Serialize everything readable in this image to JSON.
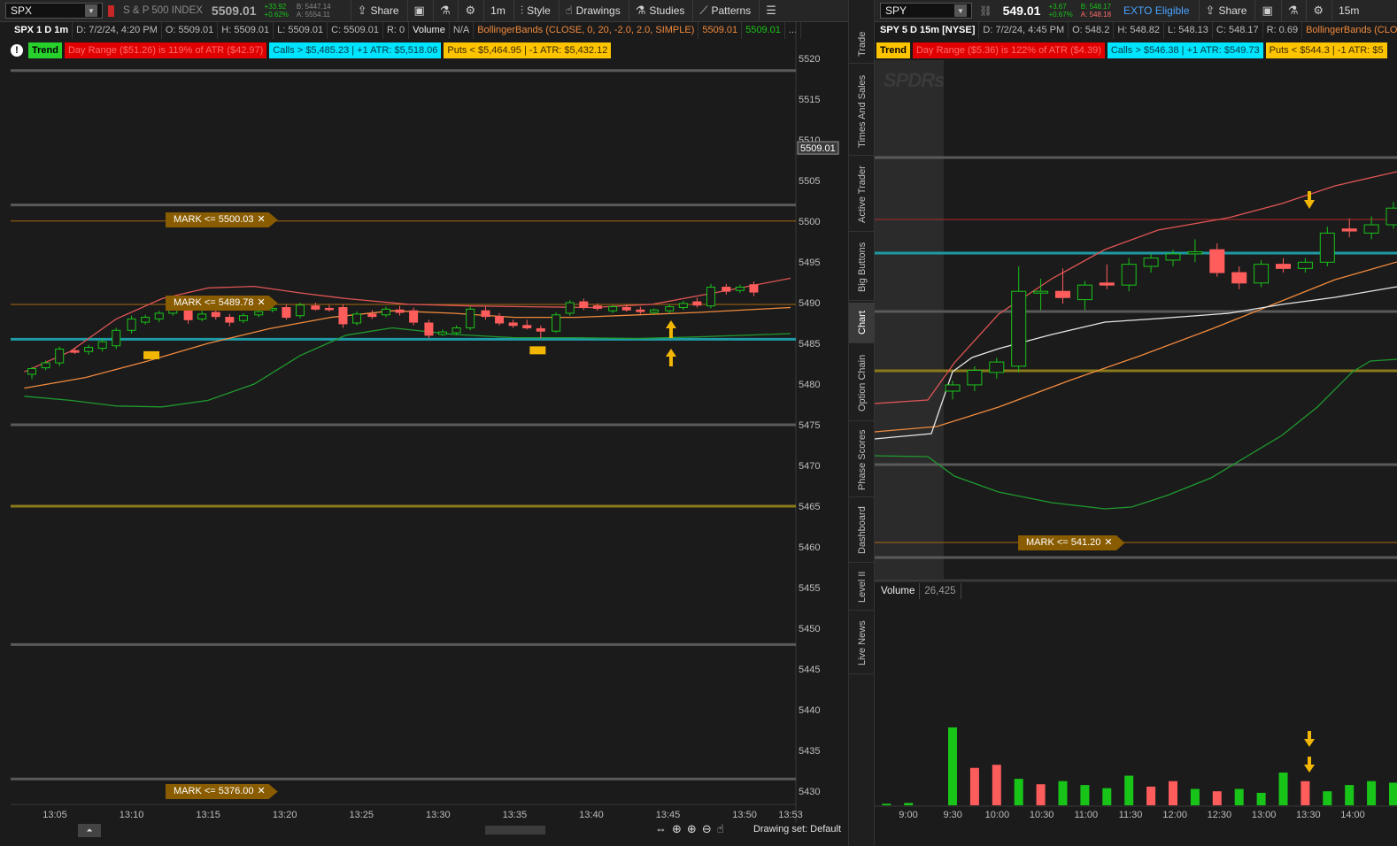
{
  "colors": {
    "up": "#19c419",
    "down": "#ff5c5c",
    "bb_upper": "#e05555",
    "bb_mid": "#f08a3e",
    "bb_lower": "#1f9a2f",
    "mark": "#8a5c00",
    "arrow": "#f2b705",
    "cyan_line": "#1e9aa6",
    "olive_line": "#8a7a1a"
  },
  "left": {
    "symbol": "SPX",
    "symbol_name": "S & P 500 INDEX",
    "last": "5509.01",
    "chg_abs": "+33.92",
    "chg_pct": "+0.62%",
    "bid": "B: 5447.14",
    "ask": "A: 5554.11",
    "toolbar": {
      "share": "Share",
      "interval": "1m",
      "style": "Style",
      "drawings": "Drawings",
      "studies": "Studies",
      "patterns": "Patterns"
    },
    "info": {
      "title": "SPX 1 D 1m",
      "date": "D: 7/2/24, 4:20 PM",
      "open": "O: 5509.01",
      "high": "H: 5509.01",
      "low": "L: 5509.01",
      "close": "C: 5509.01",
      "range": "R: 0",
      "volume_label": "Volume",
      "volume_value": "N/A",
      "bb_study": "BollingerBands (CLOSE, 0, 20, -2.0, 2.0, SIMPLE)",
      "bb_v1": "5509.01",
      "bb_v2": "5509.01",
      "more": "..."
    },
    "labels": {
      "trend": "Trend",
      "day_range": "Day Range ($51.26) is 119% of ATR ($42.97)",
      "calls": "Calls > $5,485.23 | +1 ATR: $5,518.06",
      "puts": "Puts < $5,464.95 | -1 ATR: $5,432.12"
    },
    "marks": [
      {
        "text": "MARK <= 5500.03",
        "close": "✕"
      },
      {
        "text": "MARK <= 5489.78",
        "close": "✕"
      },
      {
        "text": "MARK <= 5376.00",
        "close": "✕"
      }
    ],
    "last_tag": "5509.01",
    "drawing_set": "Drawing set: Default"
  },
  "right": {
    "symbol": "SPY",
    "last": "549.01",
    "chg_abs": "+3.67",
    "chg_pct": "+0.67%",
    "bid": "B: 548.17",
    "ask": "A: 548.18",
    "exto": "EXTO Eligible",
    "toolbar": {
      "share": "Share",
      "interval": "15m"
    },
    "info": {
      "title": "SPY 5 D 15m [NYSE]",
      "date": "D: 7/2/24, 4:45 PM",
      "open": "O: 548.2",
      "high": "H: 548.82",
      "low": "L: 548.13",
      "close": "C: 548.17",
      "range": "R: 0.69",
      "bb_study": "BollingerBands (CLO"
    },
    "labels": {
      "trend": "Trend",
      "day_range": "Day Range ($5.36) is 122% of ATR ($4.39)",
      "calls": "Calls > $546.38 | +1 ATR: $549.73",
      "puts": "Puts < $544.3 | -1 ATR: $5"
    },
    "marks": [
      {
        "text": "MARK <= 541.20",
        "close": "✕"
      }
    ],
    "watermark": "SPDRs",
    "volume_label": "Volume",
    "volume_value": "26,425"
  },
  "side_tabs": [
    "Trade",
    "Times And Sales",
    "Active Trader",
    "Big Buttons",
    "Chart",
    "Option Chain",
    "Phase Scores",
    "Dashboard",
    "Level II",
    "Live News"
  ],
  "chart_data": [
    {
      "type": "candlestick",
      "title": "SPX 1 D 1m",
      "y_ticks": [
        5520,
        5515,
        5510,
        5505,
        5500,
        5495,
        5490,
        5485,
        5480,
        5475,
        5470,
        5465,
        5460,
        5455,
        5450,
        5445,
        5440,
        5435,
        5430
      ],
      "ylim": [
        5428,
        5522
      ],
      "x_ticks": [
        "13:05",
        "13:10",
        "13:15",
        "13:20",
        "13:25",
        "13:30",
        "13:35",
        "13:40",
        "13:45",
        "13:50",
        "13:53"
      ],
      "xlim_minutes": [
        783,
        833
      ],
      "candles": [
        {
          "t": 783.5,
          "o": 5481.2,
          "h": 5482.1,
          "l": 5480.6,
          "c": 5481.9
        },
        {
          "t": 784.4,
          "o": 5482.0,
          "h": 5482.9,
          "l": 5481.7,
          "c": 5482.6
        },
        {
          "t": 785.3,
          "o": 5482.6,
          "h": 5484.6,
          "l": 5482.2,
          "c": 5484.3
        },
        {
          "t": 786.3,
          "o": 5484.1,
          "h": 5484.4,
          "l": 5483.7,
          "c": 5483.9
        },
        {
          "t": 787.2,
          "o": 5484.0,
          "h": 5484.8,
          "l": 5483.6,
          "c": 5484.5
        },
        {
          "t": 788.1,
          "o": 5484.4,
          "h": 5485.6,
          "l": 5484.0,
          "c": 5485.2
        },
        {
          "t": 789.0,
          "o": 5484.7,
          "h": 5486.9,
          "l": 5484.3,
          "c": 5486.6
        },
        {
          "t": 790.0,
          "o": 5486.6,
          "h": 5488.4,
          "l": 5486.2,
          "c": 5488.0
        },
        {
          "t": 790.9,
          "o": 5487.6,
          "h": 5488.5,
          "l": 5487.3,
          "c": 5488.2
        },
        {
          "t": 791.8,
          "o": 5488.0,
          "h": 5489.0,
          "l": 5487.6,
          "c": 5488.7
        },
        {
          "t": 792.7,
          "o": 5488.7,
          "h": 5489.6,
          "l": 5488.4,
          "c": 5489.3
        },
        {
          "t": 793.7,
          "o": 5489.3,
          "h": 5489.8,
          "l": 5487.4,
          "c": 5487.9
        },
        {
          "t": 794.6,
          "o": 5488.0,
          "h": 5489.0,
          "l": 5487.7,
          "c": 5488.6
        },
        {
          "t": 795.5,
          "o": 5488.8,
          "h": 5489.3,
          "l": 5487.9,
          "c": 5488.3
        },
        {
          "t": 796.4,
          "o": 5488.2,
          "h": 5488.6,
          "l": 5487.1,
          "c": 5487.6
        },
        {
          "t": 797.3,
          "o": 5487.8,
          "h": 5488.7,
          "l": 5487.5,
          "c": 5488.4
        },
        {
          "t": 798.3,
          "o": 5488.5,
          "h": 5489.2,
          "l": 5488.2,
          "c": 5488.9
        },
        {
          "t": 799.2,
          "o": 5489.1,
          "h": 5489.6,
          "l": 5488.8,
          "c": 5489.3
        },
        {
          "t": 800.1,
          "o": 5489.4,
          "h": 5489.8,
          "l": 5487.9,
          "c": 5488.2
        },
        {
          "t": 801.0,
          "o": 5488.4,
          "h": 5490.0,
          "l": 5488.1,
          "c": 5489.7
        },
        {
          "t": 802.0,
          "o": 5489.6,
          "h": 5490.0,
          "l": 5489.0,
          "c": 5489.2
        },
        {
          "t": 802.9,
          "o": 5489.3,
          "h": 5489.7,
          "l": 5488.9,
          "c": 5489.2
        },
        {
          "t": 803.8,
          "o": 5489.4,
          "h": 5489.8,
          "l": 5486.9,
          "c": 5487.4
        },
        {
          "t": 804.7,
          "o": 5487.5,
          "h": 5488.9,
          "l": 5487.2,
          "c": 5488.6
        },
        {
          "t": 805.7,
          "o": 5488.6,
          "h": 5489.1,
          "l": 5488.0,
          "c": 5488.3
        },
        {
          "t": 806.6,
          "o": 5488.5,
          "h": 5489.5,
          "l": 5488.2,
          "c": 5489.2
        },
        {
          "t": 807.5,
          "o": 5489.1,
          "h": 5489.6,
          "l": 5488.4,
          "c": 5488.8
        },
        {
          "t": 808.4,
          "o": 5489.0,
          "h": 5489.4,
          "l": 5487.2,
          "c": 5487.6
        },
        {
          "t": 809.4,
          "o": 5487.5,
          "h": 5487.9,
          "l": 5485.6,
          "c": 5486.0
        },
        {
          "t": 810.3,
          "o": 5486.1,
          "h": 5486.7,
          "l": 5485.9,
          "c": 5486.4
        },
        {
          "t": 811.2,
          "o": 5486.3,
          "h": 5487.2,
          "l": 5486.0,
          "c": 5486.9
        },
        {
          "t": 812.1,
          "o": 5486.9,
          "h": 5489.5,
          "l": 5486.6,
          "c": 5489.2
        },
        {
          "t": 813.1,
          "o": 5489.0,
          "h": 5489.5,
          "l": 5487.9,
          "c": 5488.3
        },
        {
          "t": 814.0,
          "o": 5488.3,
          "h": 5488.7,
          "l": 5487.2,
          "c": 5487.5
        },
        {
          "t": 814.9,
          "o": 5487.5,
          "h": 5487.9,
          "l": 5486.9,
          "c": 5487.2
        },
        {
          "t": 815.8,
          "o": 5487.2,
          "h": 5487.9,
          "l": 5486.7,
          "c": 5486.9
        },
        {
          "t": 816.7,
          "o": 5486.8,
          "h": 5487.2,
          "l": 5485.6,
          "c": 5486.5
        },
        {
          "t": 817.7,
          "o": 5486.5,
          "h": 5488.8,
          "l": 5486.3,
          "c": 5488.5
        },
        {
          "t": 818.6,
          "o": 5488.7,
          "h": 5490.3,
          "l": 5488.4,
          "c": 5490.0
        },
        {
          "t": 819.5,
          "o": 5490.1,
          "h": 5490.5,
          "l": 5489.1,
          "c": 5489.4
        },
        {
          "t": 820.4,
          "o": 5489.6,
          "h": 5489.9,
          "l": 5489.0,
          "c": 5489.3
        },
        {
          "t": 821.4,
          "o": 5489.0,
          "h": 5489.7,
          "l": 5488.7,
          "c": 5489.5
        },
        {
          "t": 822.3,
          "o": 5489.4,
          "h": 5489.8,
          "l": 5488.9,
          "c": 5489.1
        },
        {
          "t": 823.2,
          "o": 5489.1,
          "h": 5489.5,
          "l": 5488.6,
          "c": 5488.9
        },
        {
          "t": 824.1,
          "o": 5488.8,
          "h": 5489.3,
          "l": 5488.6,
          "c": 5489.1
        },
        {
          "t": 825.1,
          "o": 5489.0,
          "h": 5489.8,
          "l": 5488.7,
          "c": 5489.5
        },
        {
          "t": 826.0,
          "o": 5489.4,
          "h": 5490.2,
          "l": 5489.1,
          "c": 5489.9
        },
        {
          "t": 826.9,
          "o": 5490.1,
          "h": 5490.6,
          "l": 5489.4,
          "c": 5489.7
        },
        {
          "t": 827.8,
          "o": 5489.6,
          "h": 5492.3,
          "l": 5489.3,
          "c": 5491.9
        },
        {
          "t": 828.8,
          "o": 5491.9,
          "h": 5492.3,
          "l": 5491.0,
          "c": 5491.4
        },
        {
          "t": 829.7,
          "o": 5491.5,
          "h": 5492.2,
          "l": 5491.2,
          "c": 5491.9
        },
        {
          "t": 830.6,
          "o": 5492.2,
          "h": 5492.6,
          "l": 5490.8,
          "c": 5491.3
        }
      ],
      "bb_upper": [
        [
          783,
          5481.5
        ],
        [
          786,
          5484
        ],
        [
          789,
          5488
        ],
        [
          792,
          5490.5
        ],
        [
          795,
          5491.8
        ],
        [
          798,
          5492
        ],
        [
          801,
          5491.2
        ],
        [
          804,
          5490.5
        ],
        [
          808,
          5489.8
        ],
        [
          812,
          5489.6
        ],
        [
          816,
          5489.5
        ],
        [
          820,
          5489.4
        ],
        [
          824,
          5489.8
        ],
        [
          828,
          5491.2
        ],
        [
          833,
          5493
        ]
      ],
      "bb_mid": [
        [
          783,
          5479.5
        ],
        [
          787,
          5480.8
        ],
        [
          791,
          5482.8
        ],
        [
          795,
          5485
        ],
        [
          799,
          5486.8
        ],
        [
          803,
          5488.2
        ],
        [
          807,
          5489
        ],
        [
          811,
          5488.7
        ],
        [
          815,
          5488.2
        ],
        [
          819,
          5488.2
        ],
        [
          823,
          5488.5
        ],
        [
          827,
          5488.8
        ],
        [
          833,
          5489.4
        ]
      ],
      "bb_lower": [
        [
          783,
          5478.5
        ],
        [
          786,
          5478
        ],
        [
          789,
          5477.3
        ],
        [
          792,
          5477.2
        ],
        [
          795,
          5478
        ],
        [
          798,
          5480
        ],
        [
          801,
          5483.5
        ],
        [
          804,
          5486
        ],
        [
          807,
          5486.9
        ],
        [
          811,
          5486.1
        ],
        [
          815,
          5485.7
        ],
        [
          819,
          5485.7
        ],
        [
          823,
          5485.6
        ],
        [
          827,
          5485.8
        ],
        [
          833,
          5486.2
        ]
      ],
      "h_lines": [
        {
          "y": 5518.5,
          "color": "grey"
        },
        {
          "y": 5502,
          "color": "grey"
        },
        {
          "y": 5500.03,
          "color": "orange"
        },
        {
          "y": 5489.78,
          "color": "orange"
        },
        {
          "y": 5485.5,
          "color": "cyan"
        },
        {
          "y": 5475,
          "color": "grey"
        },
        {
          "y": 5465,
          "color": "olive"
        },
        {
          "y": 5448,
          "color": "grey"
        },
        {
          "y": 5431.5,
          "color": "grey"
        }
      ],
      "arrows": [
        {
          "t": 825.2,
          "y": 5484.5,
          "dir": "up"
        },
        {
          "t": 825.2,
          "y": 5483.4,
          "dir": "up"
        }
      ],
      "markers": [
        {
          "t": 791.3,
          "y": 5483.6
        },
        {
          "t": 816.5,
          "y": 5484.2
        }
      ]
    },
    {
      "type": "candlestick",
      "title": "SPY 5 D 15m [NYSE]",
      "ylim": [
        534,
        558
      ],
      "x_ticks": [
        "9:00",
        "9:30",
        "10:00",
        "10:30",
        "11:00",
        "11:30",
        "12:00",
        "12:30",
        "13:00",
        "13:30",
        "14:00"
      ],
      "candles": [
        {
          "i": 0,
          "o": 542.0,
          "h": 542.5,
          "l": 541.6,
          "c": 542.3
        },
        {
          "i": 1,
          "o": 542.3,
          "h": 543.2,
          "l": 542.0,
          "c": 543.0
        },
        {
          "i": 2,
          "o": 542.9,
          "h": 543.6,
          "l": 542.6,
          "c": 543.4
        },
        {
          "i": 3,
          "o": 543.2,
          "h": 548.0,
          "l": 542.9,
          "c": 546.8
        },
        {
          "i": 4,
          "o": 546.8,
          "h": 547.4,
          "l": 545.9,
          "c": 546.8
        },
        {
          "i": 5,
          "o": 546.8,
          "h": 547.9,
          "l": 546.2,
          "c": 546.5
        },
        {
          "i": 6,
          "o": 546.4,
          "h": 547.3,
          "l": 545.9,
          "c": 547.1
        },
        {
          "i": 7,
          "o": 547.2,
          "h": 548.1,
          "l": 546.9,
          "c": 547.1
        },
        {
          "i": 8,
          "o": 547.1,
          "h": 548.4,
          "l": 546.8,
          "c": 548.1
        },
        {
          "i": 9,
          "o": 548.0,
          "h": 548.6,
          "l": 547.7,
          "c": 548.4
        },
        {
          "i": 10,
          "o": 548.3,
          "h": 548.8,
          "l": 548.0,
          "c": 548.6
        },
        {
          "i": 11,
          "o": 548.6,
          "h": 549.3,
          "l": 548.2,
          "c": 548.7
        },
        {
          "i": 12,
          "o": 548.8,
          "h": 549.1,
          "l": 547.5,
          "c": 547.7
        },
        {
          "i": 13,
          "o": 547.7,
          "h": 548.0,
          "l": 546.9,
          "c": 547.2
        },
        {
          "i": 14,
          "o": 547.2,
          "h": 548.3,
          "l": 547.0,
          "c": 548.1
        },
        {
          "i": 15,
          "o": 548.1,
          "h": 548.4,
          "l": 547.7,
          "c": 547.9
        },
        {
          "i": 16,
          "o": 547.9,
          "h": 548.4,
          "l": 547.7,
          "c": 548.2
        },
        {
          "i": 17,
          "o": 548.2,
          "h": 549.9,
          "l": 548.0,
          "c": 549.6
        },
        {
          "i": 18,
          "o": 549.8,
          "h": 550.3,
          "l": 549.4,
          "c": 549.7
        },
        {
          "i": 19,
          "o": 549.6,
          "h": 550.4,
          "l": 549.3,
          "c": 550.0
        },
        {
          "i": 20,
          "o": 550.0,
          "h": 551.1,
          "l": 549.8,
          "c": 550.8
        },
        {
          "i": 21,
          "o": 550.8,
          "h": 551.6,
          "l": 550.5,
          "c": 551.4
        },
        {
          "i": 22,
          "o": 551.4,
          "h": 551.9,
          "l": 551.1,
          "c": 551.6
        }
      ],
      "volume_bars": [
        {
          "i": -3,
          "v": 0.02,
          "up": true
        },
        {
          "i": -2,
          "v": 0.03,
          "up": true
        },
        {
          "i": 0,
          "v": 1.0,
          "up": true
        },
        {
          "i": 1,
          "v": 0.48,
          "up": false
        },
        {
          "i": 2,
          "v": 0.52,
          "up": false
        },
        {
          "i": 3,
          "v": 0.34,
          "up": true
        },
        {
          "i": 4,
          "v": 0.27,
          "up": false
        },
        {
          "i": 5,
          "v": 0.31,
          "up": true
        },
        {
          "i": 6,
          "v": 0.26,
          "up": true
        },
        {
          "i": 7,
          "v": 0.22,
          "up": true
        },
        {
          "i": 8,
          "v": 0.38,
          "up": true
        },
        {
          "i": 9,
          "v": 0.24,
          "up": false
        },
        {
          "i": 10,
          "v": 0.31,
          "up": false
        },
        {
          "i": 11,
          "v": 0.21,
          "up": true
        },
        {
          "i": 12,
          "v": 0.18,
          "up": false
        },
        {
          "i": 13,
          "v": 0.21,
          "up": true
        },
        {
          "i": 14,
          "v": 0.16,
          "up": true
        },
        {
          "i": 15,
          "v": 0.42,
          "up": true
        },
        {
          "i": 16,
          "v": 0.31,
          "up": false
        },
        {
          "i": 17,
          "v": 0.18,
          "up": true
        },
        {
          "i": 18,
          "v": 0.26,
          "up": true
        },
        {
          "i": 19,
          "v": 0.31,
          "up": true
        },
        {
          "i": 20,
          "v": 0.29,
          "up": true
        }
      ]
    }
  ]
}
